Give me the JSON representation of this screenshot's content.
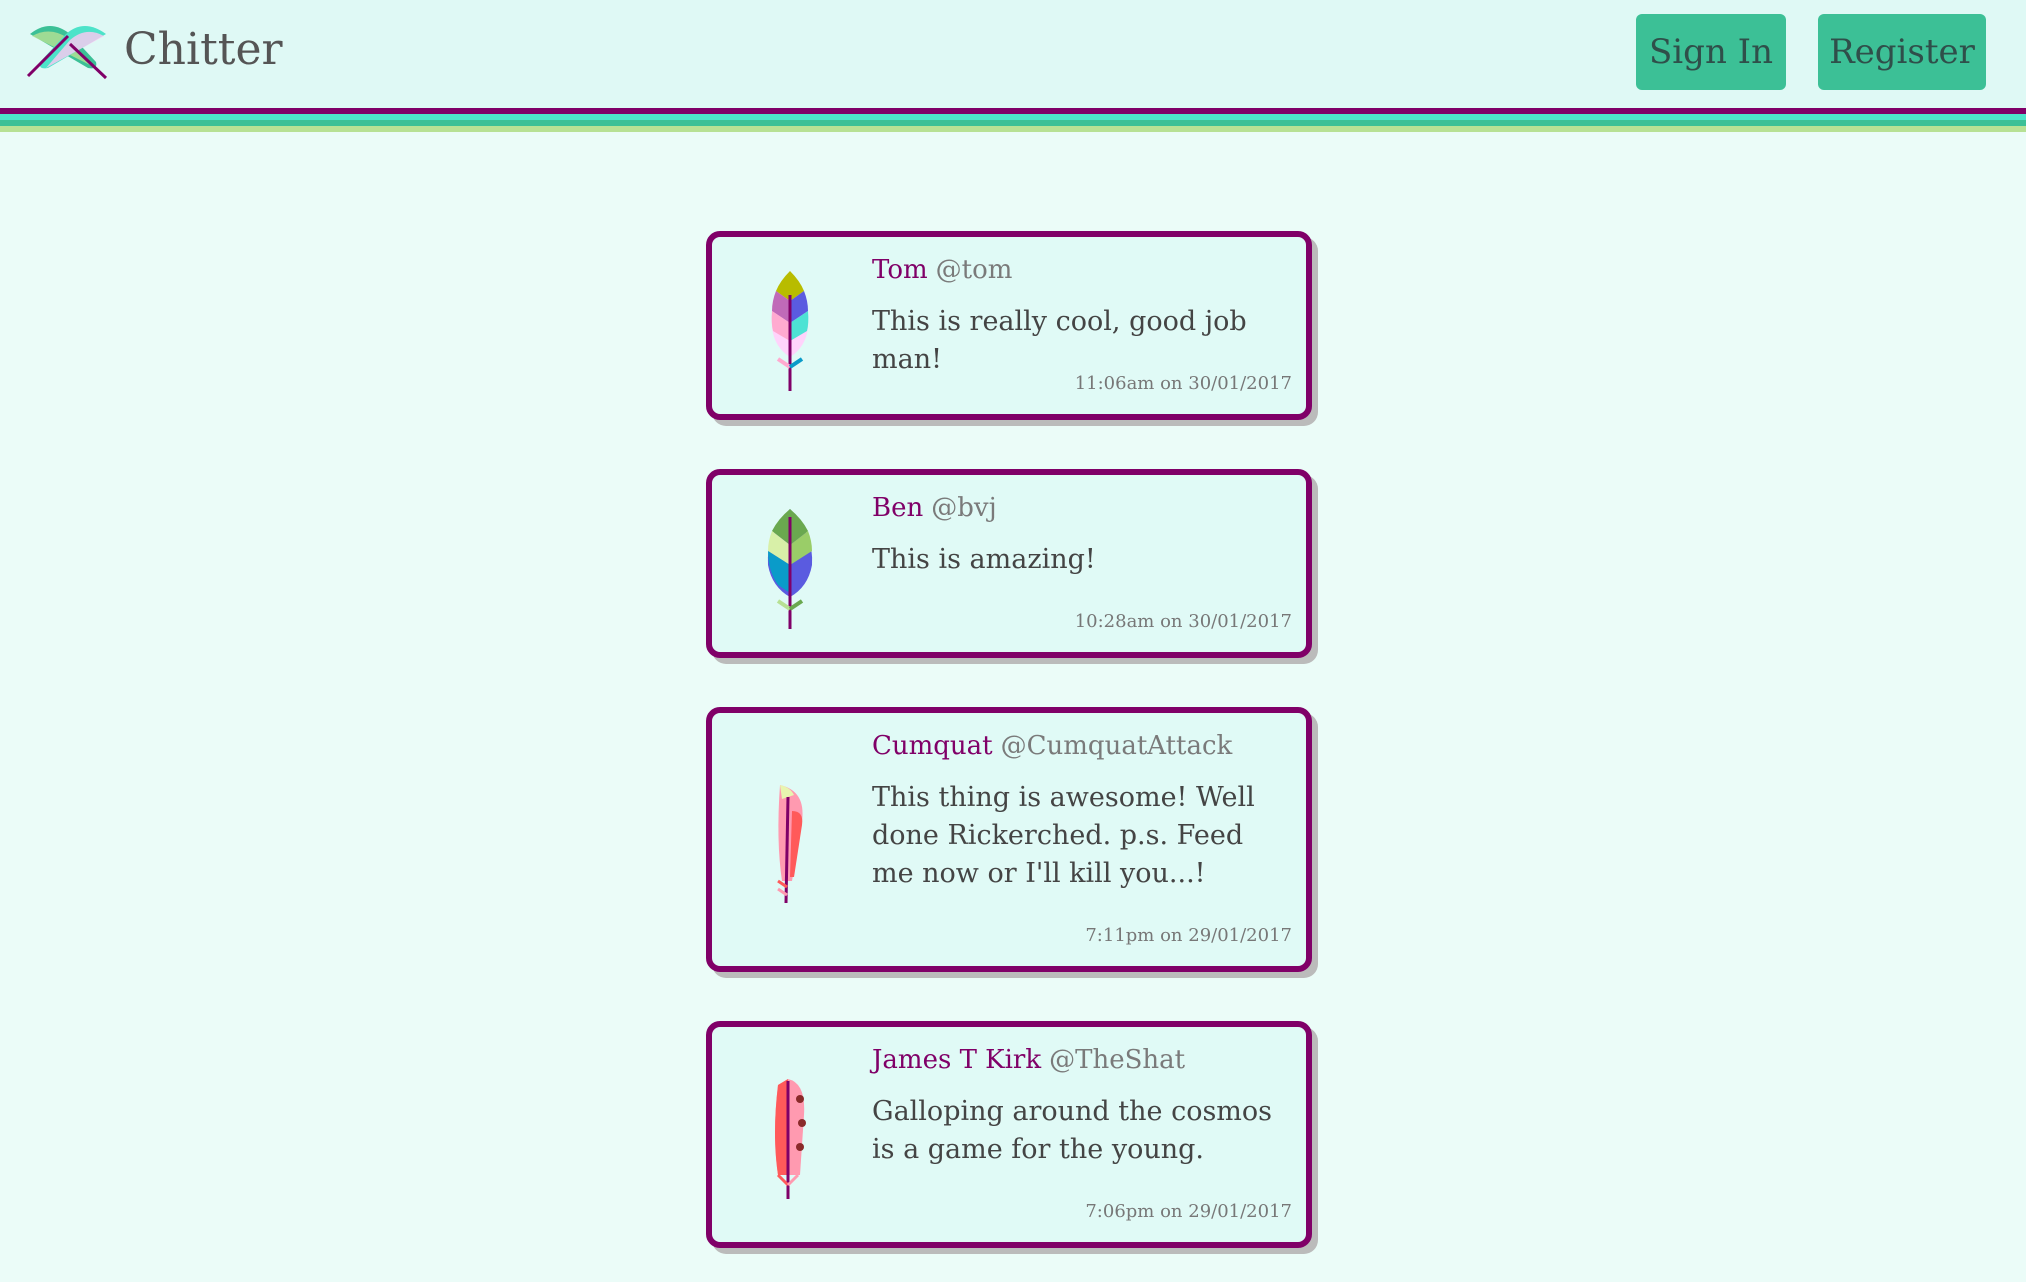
{
  "header": {
    "brand": "Chitter",
    "sign_in": "Sign In",
    "register": "Register"
  },
  "colors": {
    "accent": "#800068",
    "button": "#3cc096",
    "stripe_teal": "#4de3c9",
    "stripe_green": "#3cc096",
    "stripe_lime": "#b7e194"
  },
  "peeps": [
    {
      "name": "Tom",
      "handle": "@tom",
      "message": "This is really cool, good job man!",
      "time": "11:06am on 30/01/2017",
      "icon": "rainbow-feather-icon"
    },
    {
      "name": "Ben",
      "handle": "@bvj",
      "message": "This is amazing!",
      "time": "10:28am on 30/01/2017",
      "icon": "green-blue-feather-icon"
    },
    {
      "name": "Cumquat",
      "handle": "@CumquatAttack",
      "message": "This thing is awesome! Well done Rickerched. p.s. Feed me now or I'll kill you...!",
      "time": "7:11pm on 29/01/2017",
      "icon": "pink-red-feather-icon"
    },
    {
      "name": "James T Kirk",
      "handle": "@TheShat",
      "message": "Galloping around the cosmos is a game for the young.",
      "time": "7:06pm on 29/01/2017",
      "icon": "spotted-red-feather-icon"
    }
  ]
}
